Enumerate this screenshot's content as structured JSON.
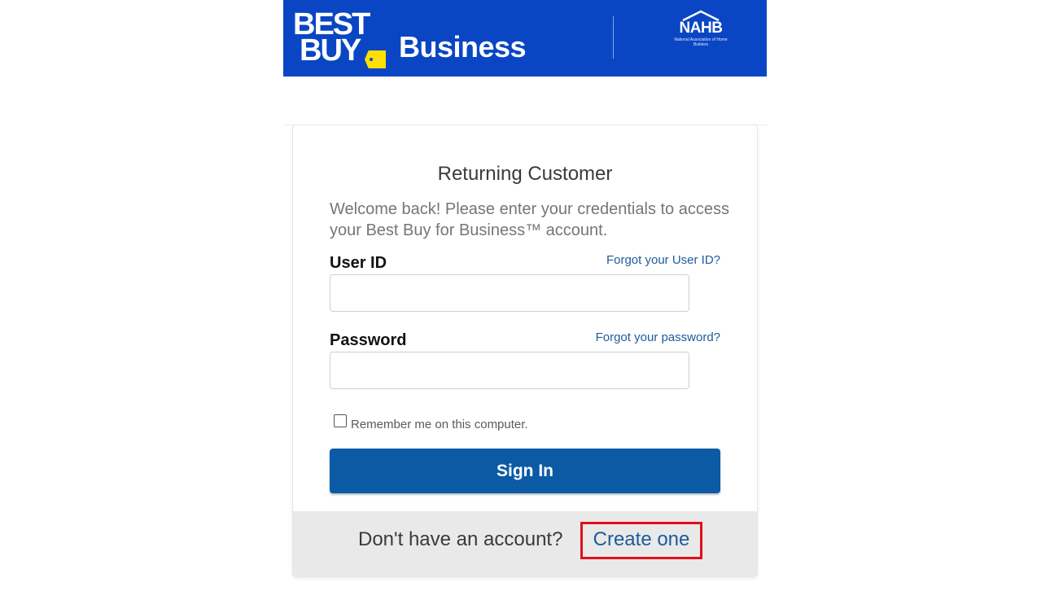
{
  "header": {
    "brand_line1": "BEST",
    "brand_line2": "BUY",
    "brand_suffix": "Business",
    "partner_logo": "NAHB",
    "partner_subtext": "National Association of Home Builders",
    "background_color": "#0a46c4",
    "tag_color": "#ffe000"
  },
  "login": {
    "title": "Returning Customer",
    "intro": "Welcome back! Please enter your credentials to access your Best Buy for Business™ account.",
    "user_id_label": "User ID",
    "user_id_value": "",
    "forgot_user_id": "Forgot your User ID?",
    "password_label": "Password",
    "password_value": "",
    "forgot_password": "Forgot your password?",
    "remember_label": "Remember me on this computer.",
    "remember_checked": false,
    "sign_in_label": "Sign In",
    "button_color": "#0b5aa5",
    "link_color": "#1d5b9b"
  },
  "footer": {
    "prompt": "Don't have an account?",
    "create_link": "Create one",
    "highlight_color": "#e0101a"
  }
}
